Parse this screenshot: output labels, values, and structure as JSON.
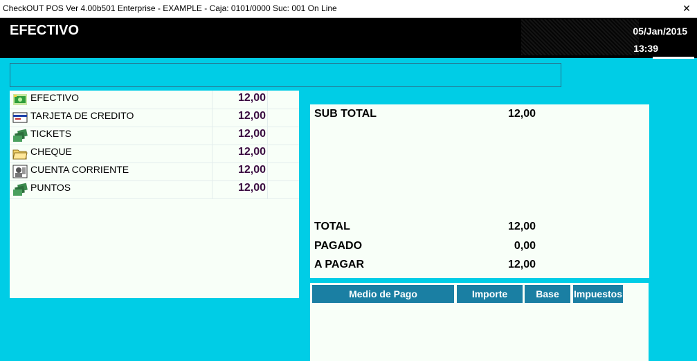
{
  "window": {
    "title": "CheckOUT POS Ver 4.00b501 Enterprise - EXAMPLE - Caja: 0101/0000 Suc: 001  On Line",
    "close": "✕"
  },
  "header": {
    "title": "EFECTIVO",
    "date": "05/Jan/2015",
    "time": "13:39"
  },
  "message": "",
  "payment_methods": [
    {
      "label": "EFECTIVO",
      "value": "12,00",
      "icon": "cash-icon"
    },
    {
      "label": "TARJETA DE CREDITO",
      "value": "12,00",
      "icon": "credit-card-icon"
    },
    {
      "label": "TICKETS",
      "value": "12,00",
      "icon": "tickets-icon"
    },
    {
      "label": "CHEQUE",
      "value": "12,00",
      "icon": "cheque-icon"
    },
    {
      "label": "CUENTA CORRIENTE",
      "value": "12,00",
      "icon": "account-icon"
    },
    {
      "label": "PUNTOS",
      "value": "12,00",
      "icon": "points-icon"
    }
  ],
  "totals": {
    "subtotal_label": "SUB TOTAL",
    "subtotal": "12,00",
    "total_label": "TOTAL",
    "total": "12,00",
    "pagado_label": "PAGADO",
    "pagado": "0,00",
    "apagar_label": "A PAGAR",
    "apagar": "12,00"
  },
  "grid": {
    "columns": [
      "Medio de Pago",
      "Importe",
      "Base",
      "Impuestos"
    ]
  },
  "colors": {
    "background": "#00cde6",
    "header": "#000000",
    "grid_header": "#1a7fa3",
    "value_text": "#3a0b40"
  }
}
